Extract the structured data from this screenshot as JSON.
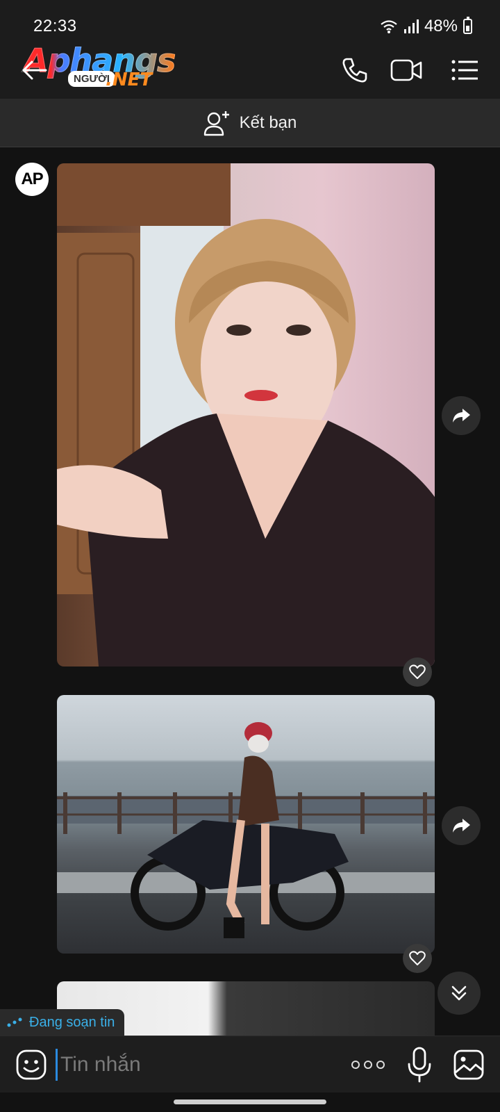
{
  "status_bar": {
    "time": "22:33",
    "battery": "48%"
  },
  "header": {
    "logo": {
      "main": "Aphangs",
      "sub": "NGƯỜI",
      "net": ".NET"
    },
    "icons": [
      "back-arrow-icon",
      "phone-icon",
      "video-call-icon",
      "menu-list-icon"
    ]
  },
  "friend_bar": {
    "label": "Kết bạn",
    "icon": "add-friend-icon"
  },
  "conversation": {
    "avatar_text": "AP",
    "messages": [
      {
        "type": "photo",
        "description_icon": "photo"
      },
      {
        "type": "photo",
        "description_icon": "photo"
      },
      {
        "type": "photo",
        "description_icon": "photo"
      }
    ]
  },
  "typing_indicator": {
    "text": "Đang soạn tin"
  },
  "composer": {
    "placeholder": "Tin nhắn",
    "value": ""
  },
  "colors": {
    "background": "#121212",
    "bar": "#1c1c1c",
    "accent": "#3ab0e8",
    "cursor": "#2b8be0"
  }
}
